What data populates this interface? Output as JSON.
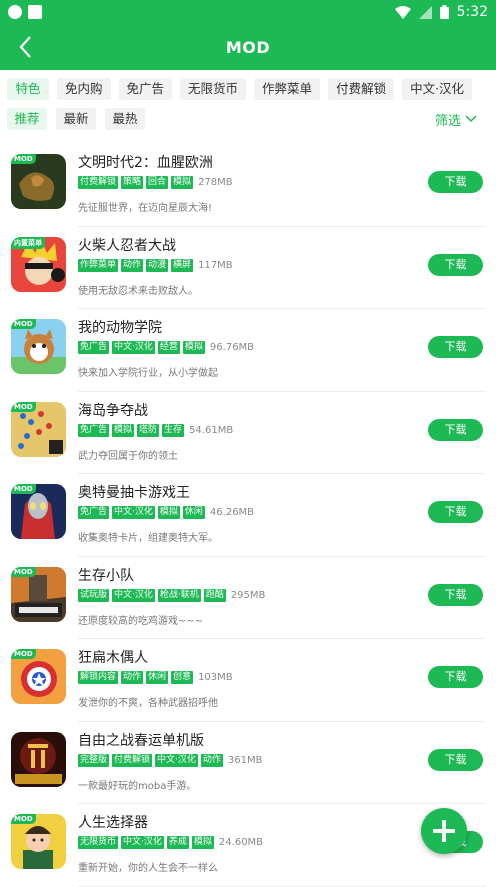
{
  "status_bar": {
    "time": "5:32"
  },
  "app_bar": {
    "title": "MOD"
  },
  "tags": [
    "特色",
    "免内购",
    "免广告",
    "无限货币",
    "作弊菜单",
    "付费解锁",
    "中文·汉化"
  ],
  "sorts": [
    "推荐",
    "最新",
    "最热"
  ],
  "filter_label": "筛选",
  "colors": {
    "accent": "#1db954"
  },
  "games": [
    {
      "name": "文明时代2：血腥欧洲",
      "tags": [
        "付费解锁",
        "策略",
        "回合",
        "模拟"
      ],
      "size": "278MB",
      "desc": "先征服世界，在迈向星辰大海!",
      "button": "下载",
      "badge": "MOD"
    },
    {
      "name": "火柴人忍者大战",
      "tags": [
        "作弊菜单",
        "动作",
        "动漫",
        "横屏"
      ],
      "size": "117MB",
      "desc": "使用无敌忍术来击败敌人。",
      "button": "下载",
      "badge": "内置菜单"
    },
    {
      "name": "我的动物学院",
      "tags": [
        "免广告",
        "中文·汉化",
        "经营",
        "模拟"
      ],
      "size": "96.76MB",
      "desc": "快来加入学院行业，从小学做起",
      "button": "下载",
      "badge": "MOD"
    },
    {
      "name": "海岛争夺战",
      "tags": [
        "免广告",
        "模拟",
        "塔防",
        "生存"
      ],
      "size": "54.61MB",
      "desc": "武力夺回属于你的领土",
      "button": "下载",
      "badge": "MOD"
    },
    {
      "name": "奥特曼抽卡游戏王",
      "tags": [
        "免广告",
        "中文·汉化",
        "模拟",
        "休闲"
      ],
      "size": "46.26MB",
      "desc": "收集奥特卡片，组建奥特大军。",
      "button": "下载",
      "badge": "MOD"
    },
    {
      "name": "生存小队",
      "tags": [
        "试玩版",
        "中文·汉化",
        "枪战·联机",
        "跑酷"
      ],
      "size": "295MB",
      "desc": "还原度较高的吃鸡游戏~~~",
      "button": "下载",
      "badge": "MOD"
    },
    {
      "name": "狂扁木偶人",
      "tags": [
        "解锁内容",
        "动作",
        "休闲",
        "创意"
      ],
      "size": "103MB",
      "desc": "发泄你的不爽，各种武器招呼他",
      "button": "下载",
      "badge": "MOD"
    },
    {
      "name": "自由之战春运单机版",
      "tags": [
        "完整版",
        "付费解锁",
        "中文·汉化",
        "动作"
      ],
      "size": "361MB",
      "desc": "一款最好玩的moba手游。",
      "button": "下载",
      "badge": ""
    },
    {
      "name": "人生选择器",
      "tags": [
        "无限货币",
        "中文·汉化",
        "养成",
        "模拟"
      ],
      "size": "24.60MB",
      "desc": "重新开始，你的人生会不一样么",
      "button": "下载",
      "badge": "MOD"
    }
  ]
}
